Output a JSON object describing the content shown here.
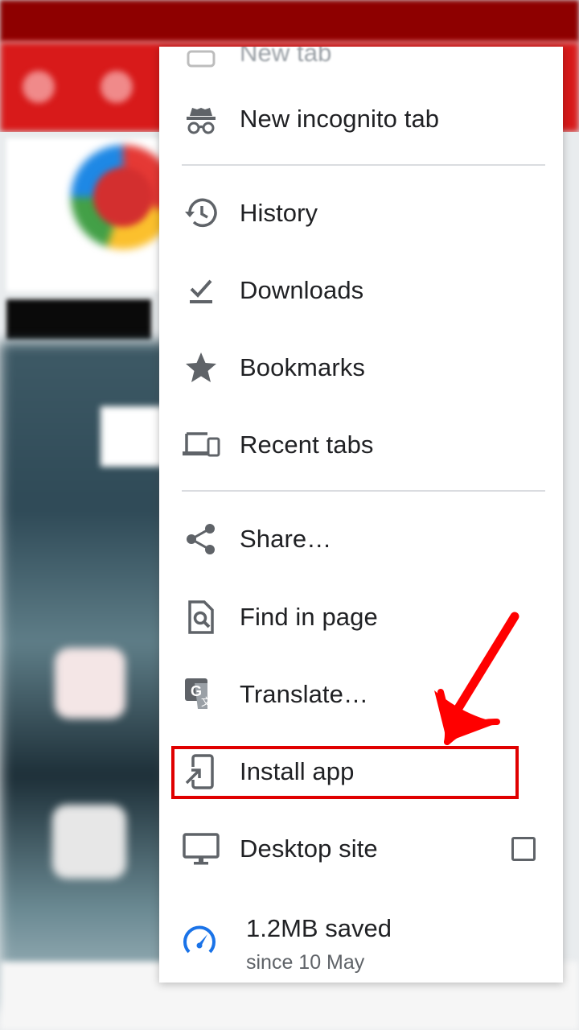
{
  "menu": {
    "partial_item": {
      "label": "New tab",
      "icon": "new-tab-icon"
    },
    "items": [
      {
        "id": "new-incognito-tab",
        "label": "New incognito tab",
        "icon": "incognito-icon"
      },
      {
        "id": "history",
        "label": "History",
        "icon": "history-icon"
      },
      {
        "id": "downloads",
        "label": "Downloads",
        "icon": "download-icon"
      },
      {
        "id": "bookmarks",
        "label": "Bookmarks",
        "icon": "star-icon"
      },
      {
        "id": "recent-tabs",
        "label": "Recent tabs",
        "icon": "devices-icon"
      },
      {
        "id": "share",
        "label": "Share…",
        "icon": "share-icon"
      },
      {
        "id": "find-in-page",
        "label": "Find in page",
        "icon": "find-in-page-icon"
      },
      {
        "id": "translate",
        "label": "Translate…",
        "icon": "translate-icon"
      },
      {
        "id": "install-app",
        "label": "Install app",
        "icon": "install-app-icon"
      },
      {
        "id": "desktop-site",
        "label": "Desktop site",
        "icon": "monitor-icon",
        "checked": false
      }
    ],
    "data_saver": {
      "title": "1.2MB saved",
      "subtitle": "since 10 May",
      "icon": "speedometer-icon"
    }
  },
  "colors": {
    "highlight": "#e00000",
    "icon_gray": "#5f6368",
    "saver_blue": "#1a73e8",
    "toolbar_red": "#d81a1a"
  }
}
